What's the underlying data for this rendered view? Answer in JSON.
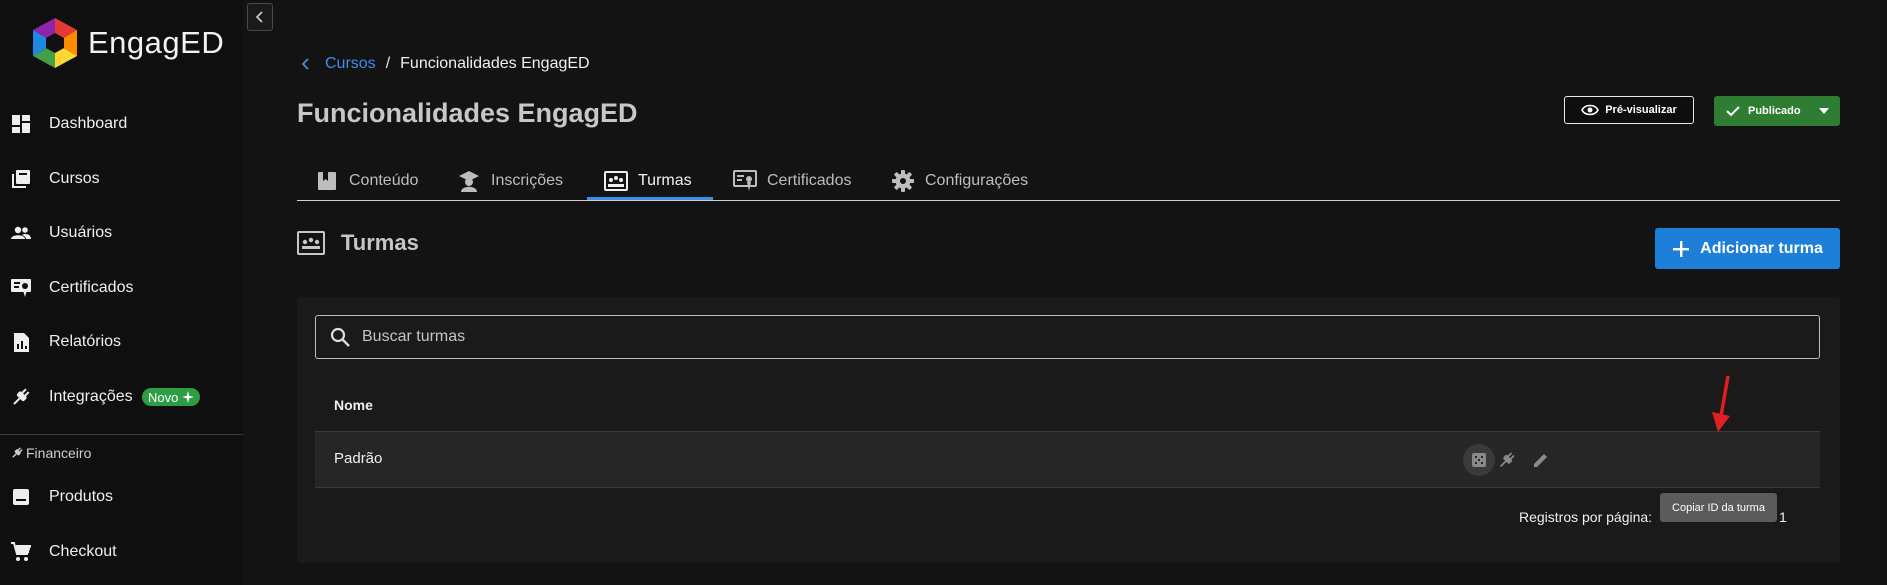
{
  "app": {
    "logo_text": "EngagED"
  },
  "sidebar": {
    "items": [
      {
        "label": "Dashboard",
        "icon": "dashboard-icon"
      },
      {
        "label": "Cursos",
        "icon": "library-books-icon"
      },
      {
        "label": "Usuários",
        "icon": "people-icon"
      },
      {
        "label": "Certificados",
        "icon": "certificate-icon"
      },
      {
        "label": "Relatórios",
        "icon": "report-icon"
      },
      {
        "label": "Integrações",
        "icon": "plug-icon",
        "badge": "Novo"
      }
    ],
    "section": {
      "label": "Financeiro",
      "icon": "finance-icon"
    },
    "finance_items": [
      {
        "label": "Produtos",
        "icon": "product-icon"
      },
      {
        "label": "Checkout",
        "icon": "cart-icon"
      }
    ]
  },
  "breadcrumb": {
    "parent": "Cursos",
    "separator": "/",
    "current": "Funcionalidades EngagED"
  },
  "page": {
    "title": "Funcionalidades EngagED"
  },
  "header_actions": {
    "preview_label": "Pré-visualizar",
    "status_label": "Publicado"
  },
  "tabs": [
    {
      "label": "Conteúdo",
      "icon": "bookmark-icon",
      "active": false
    },
    {
      "label": "Inscrições",
      "icon": "school-icon",
      "active": false
    },
    {
      "label": "Turmas",
      "icon": "class-icon",
      "active": true
    },
    {
      "label": "Certificados",
      "icon": "certificate-icon",
      "active": false
    },
    {
      "label": "Configurações",
      "icon": "gear-icon",
      "active": false
    }
  ],
  "section": {
    "title": "Turmas",
    "add_button_label": "Adicionar turma"
  },
  "search": {
    "placeholder": "Buscar turmas",
    "value": ""
  },
  "table": {
    "columns": [
      "Nome"
    ],
    "rows": [
      {
        "name": "Padrão"
      }
    ],
    "row_actions": [
      "copy-id-icon",
      "plug-icon",
      "pencil-icon"
    ],
    "tooltip": "Copiar ID da turma",
    "rows_per_page_label": "Registros por página:",
    "rows_per_page_value": "1"
  },
  "colors": {
    "accent": "#1e7fd8",
    "link": "#3d8ee8",
    "success": "#2e7d32",
    "badge": "#2e9e46",
    "annotation_arrow": "#e02020"
  }
}
